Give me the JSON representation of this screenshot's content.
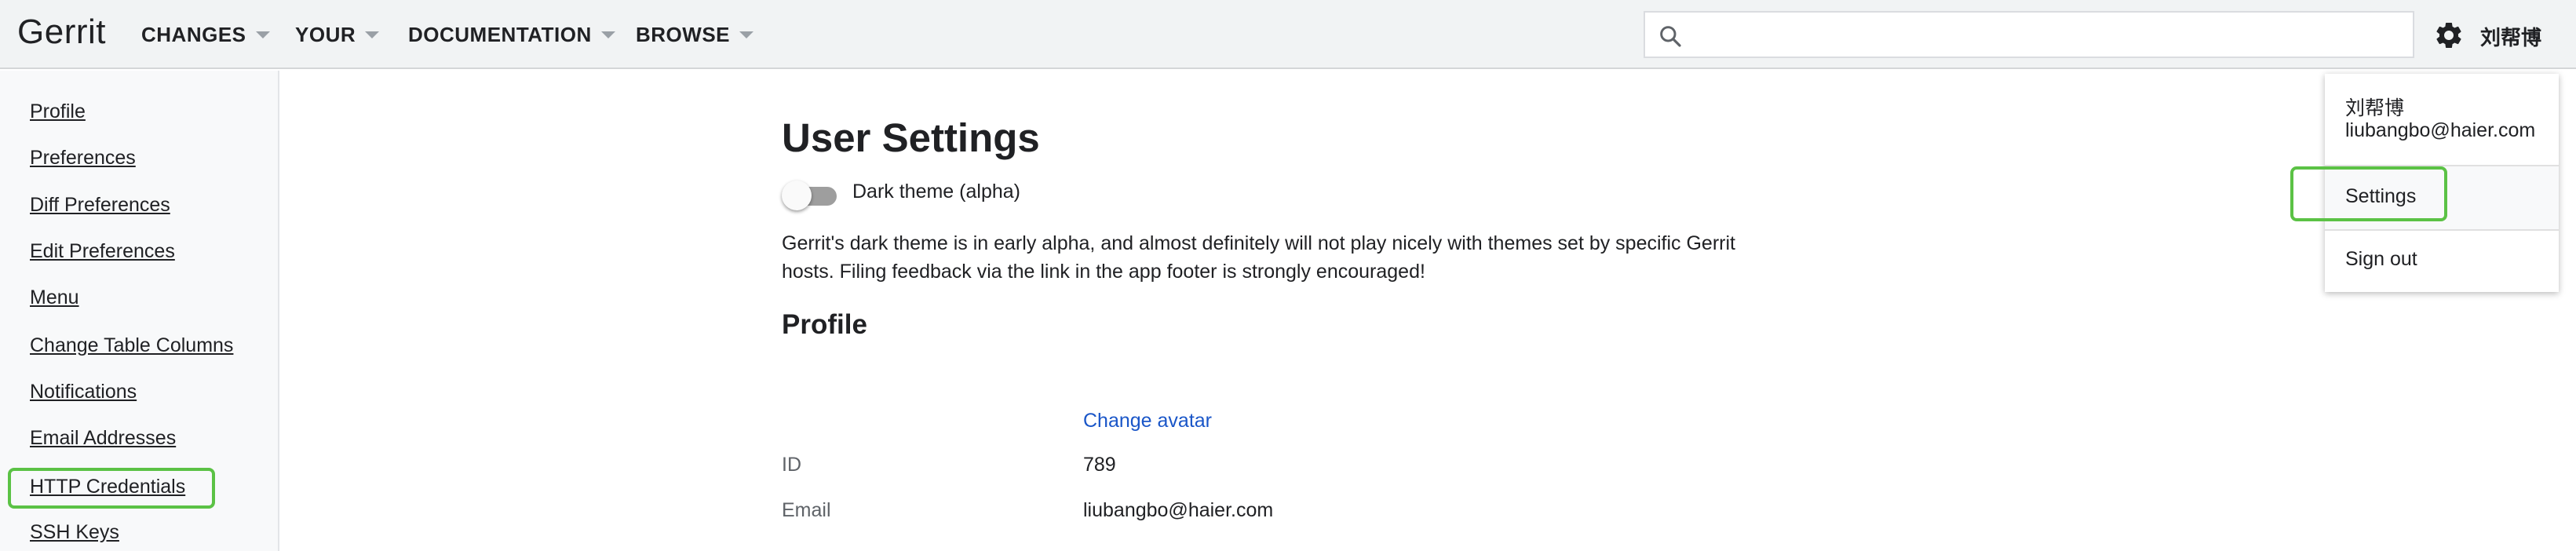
{
  "header": {
    "logo": "Gerrit",
    "nav": [
      {
        "label": "CHANGES"
      },
      {
        "label": "YOUR"
      },
      {
        "label": "DOCUMENTATION"
      },
      {
        "label": "BROWSE"
      }
    ],
    "search_value": "",
    "user_name": "刘帮博"
  },
  "sidebar": {
    "items": [
      {
        "label": "Profile"
      },
      {
        "label": "Preferences"
      },
      {
        "label": "Diff Preferences"
      },
      {
        "label": "Edit Preferences"
      },
      {
        "label": "Menu"
      },
      {
        "label": "Change Table Columns"
      },
      {
        "label": "Notifications"
      },
      {
        "label": "Email Addresses"
      },
      {
        "label": "HTTP Credentials"
      },
      {
        "label": "SSH Keys"
      }
    ]
  },
  "main": {
    "title": "User Settings",
    "dark_theme_label": "Dark theme (alpha)",
    "dark_theme_enabled": false,
    "dark_theme_description": "Gerrit's dark theme is in early alpha, and almost definitely will not play nicely with themes set by specific Gerrit hosts. Filing feedback via the link in the app footer is strongly encouraged!",
    "profile": {
      "heading": "Profile",
      "change_avatar": "Change avatar",
      "fields": [
        {
          "label": "ID",
          "value": "789"
        },
        {
          "label": "Email",
          "value": "liubangbo@haier.com"
        }
      ]
    }
  },
  "user_menu": {
    "name": "刘帮博",
    "email": "liubangbo@haier.com",
    "items": [
      {
        "label": "Settings"
      },
      {
        "label": "Sign out"
      }
    ]
  },
  "colors": {
    "header_bg": "#f1f3f4",
    "sidebar_bg": "#f8f9fa",
    "link_blue": "#1a56c8",
    "highlight_green": "#5bc245"
  },
  "icons": {
    "search": "search-icon",
    "settings": "gear-icon"
  }
}
